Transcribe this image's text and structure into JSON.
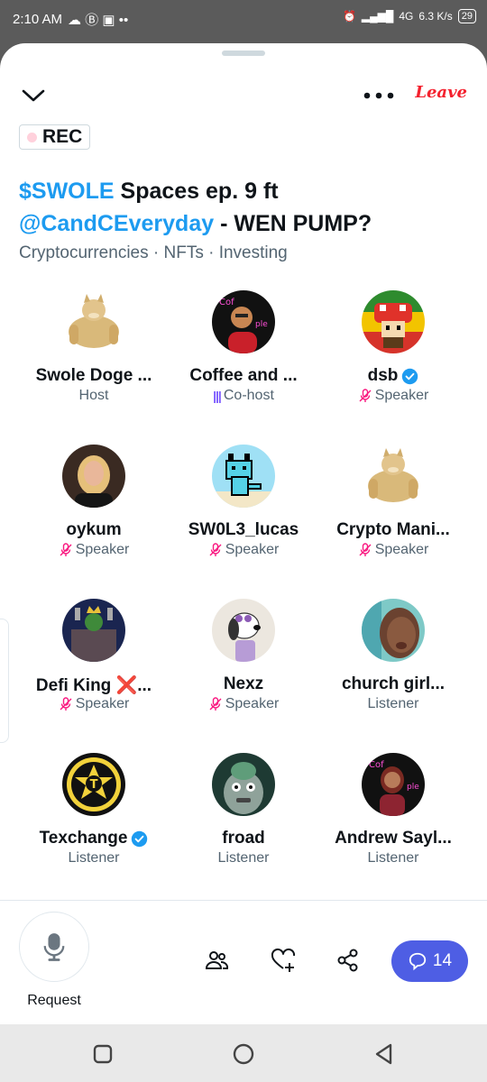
{
  "status": {
    "time": "2:10 AM",
    "network": "4G",
    "speed": "6.3 K/s",
    "battery": "29"
  },
  "header": {
    "leave_label": "Leave",
    "rec_label": "REC"
  },
  "space": {
    "title_part1": "$SWOLE",
    "title_part2": " Spaces ep. 9 ft ",
    "title_part3": "@CandCEveryday",
    "title_part4": " - WEN PUMP?",
    "topics": "Cryptocurrencies · NFTs · Investing"
  },
  "participants": [
    {
      "name": "Swole Doge ...",
      "role": "Host",
      "verified": false,
      "muted": false,
      "cohost": false,
      "avatar": "doge-avatar"
    },
    {
      "name": "Coffee and ...",
      "role": "Co-host",
      "verified": false,
      "muted": false,
      "cohost": true,
      "avatar": "neon-avatar"
    },
    {
      "name": "dsb",
      "role": "Speaker",
      "verified": true,
      "muted": true,
      "cohost": false,
      "avatar": "mushroom-avatar"
    },
    {
      "name": "oykum",
      "role": "Speaker",
      "verified": false,
      "muted": true,
      "cohost": false,
      "avatar": "woman-avatar"
    },
    {
      "name": "SW0L3_lucas",
      "role": "Speaker",
      "verified": false,
      "muted": true,
      "cohost": false,
      "avatar": "pixel-cat-avatar"
    },
    {
      "name": "Crypto Mani...",
      "role": "Speaker",
      "verified": false,
      "muted": true,
      "cohost": false,
      "avatar": "doge-avatar"
    },
    {
      "name": "Defi King ❌...",
      "role": "Speaker",
      "verified": false,
      "muted": true,
      "cohost": false,
      "avatar": "king-avatar"
    },
    {
      "name": "Nexz",
      "role": "Speaker",
      "verified": false,
      "muted": true,
      "cohost": false,
      "avatar": "snoopy-avatar"
    },
    {
      "name": "church girl...",
      "role": "Listener",
      "verified": false,
      "muted": false,
      "cohost": false,
      "avatar": "selfie-avatar"
    },
    {
      "name": "Texchange",
      "role": "Listener",
      "verified": true,
      "muted": false,
      "cohost": false,
      "avatar": "badge-avatar"
    },
    {
      "name": "froad",
      "role": "Listener",
      "verified": false,
      "muted": false,
      "cohost": false,
      "avatar": "troll-avatar"
    },
    {
      "name": "Andrew Sayl...",
      "role": "Listener",
      "verified": false,
      "muted": false,
      "cohost": false,
      "avatar": "neon-girl-avatar"
    }
  ],
  "footer": {
    "request_label": "Request",
    "chat_count": "14"
  },
  "colors": {
    "accent": "#1d9bf0",
    "leave": "#f4212e",
    "cohost": "#7856ff",
    "muted": "#f91880",
    "chat_button": "#4e5ee4"
  }
}
